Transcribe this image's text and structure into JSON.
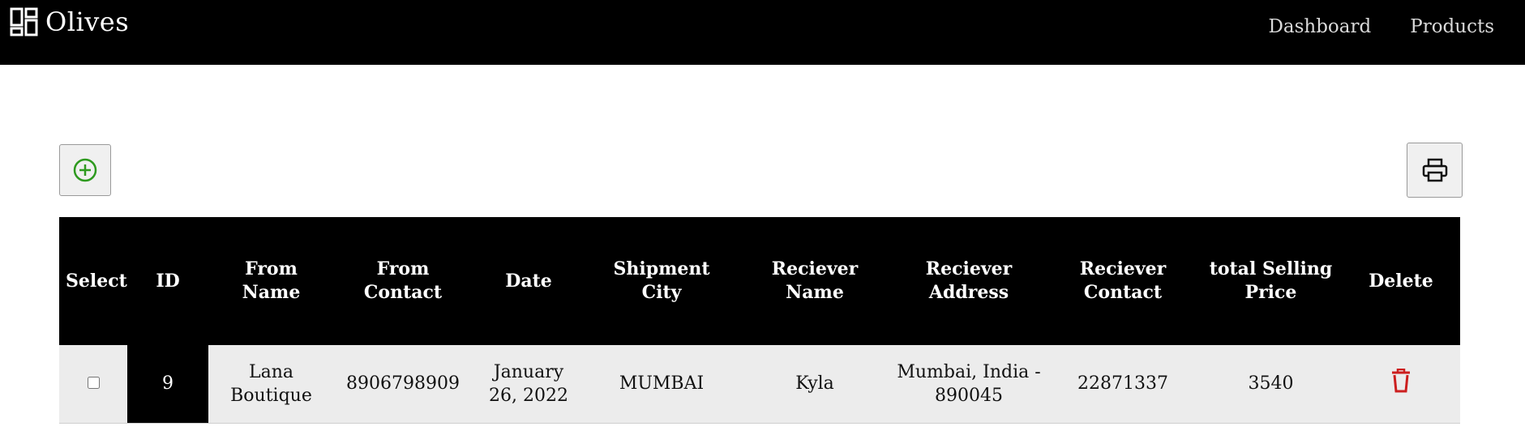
{
  "app": {
    "brand": "Olives",
    "brand_icon": "dashboard-grid-icon"
  },
  "nav": {
    "items": [
      "Dashboard",
      "Products"
    ]
  },
  "toolbar": {
    "add_icon": "plus-circle-icon",
    "print_icon": "printer-icon",
    "add_color": "#2e9a1f"
  },
  "table": {
    "headers": [
      "Select",
      "ID",
      "From Name",
      "From Contact",
      "Date",
      "Shipment City",
      "Reciever Name",
      "Reciever Address",
      "Reciever Contact",
      "total Selling Price",
      "Delete"
    ],
    "rows": [
      {
        "selected": false,
        "id": "9",
        "from_name": "Lana Boutique",
        "from_contact": "8906798909",
        "date": "January 26, 2022",
        "shipment_city": "MUMBAI",
        "receiver_name": "Kyla",
        "receiver_address": "Mumbai, India - 890045",
        "receiver_contact": "22871337",
        "total_selling_price": "3540",
        "delete_icon": "trash-icon"
      }
    ],
    "delete_color": "#cc1f1f"
  }
}
